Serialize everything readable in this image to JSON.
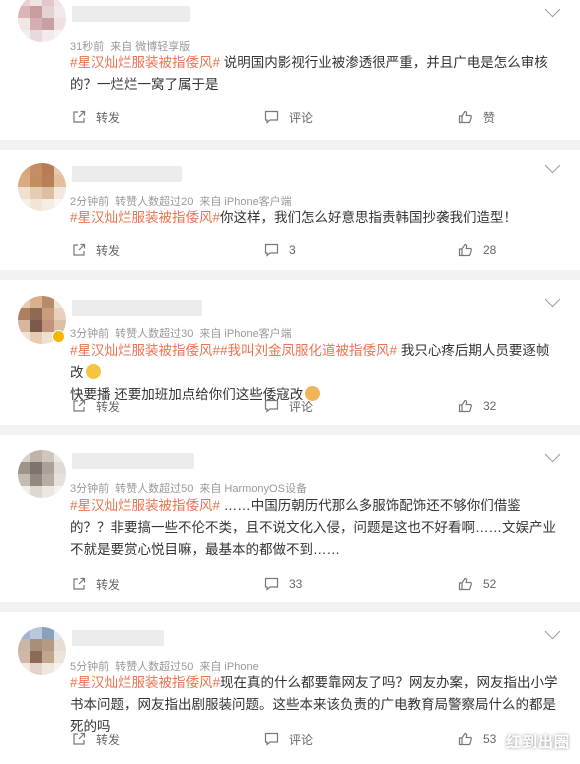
{
  "posts": [
    {
      "meta": [
        "31秒前",
        "来自 微博轻享版"
      ],
      "tag": "#星汉灿烂服装被指倭风#",
      "text": " 说明国内影视行业被渗透很严重，并且广电是怎么审核的？一烂烂一窝了属于是",
      "repost_label": "转发",
      "comment_label": "评论",
      "like_label": "赞"
    },
    {
      "meta": [
        "2分钟前",
        "转赞人数超过20",
        "来自 iPhone客户端"
      ],
      "tag": "#星汉灿烂服装被指倭风#",
      "text": "你这样，我们怎么好意思指责韩国抄袭我们造型！",
      "repost_label": "转发",
      "comment_count": "3",
      "like_count": "28"
    },
    {
      "meta": [
        "3分钟前",
        "转赞人数超过30",
        "来自 iPhone客户端"
      ],
      "tag": "#星汉灿烂服装被指倭风#",
      "tag2": "#我叫刘金凤服化道被指倭风#",
      "text": " 我只心疼后期人员要逐帧改",
      "text2": "快要播 还要加班加点给你们这些倭寇改",
      "repost_label": "转发",
      "comment_label": "评论",
      "like_count": "32"
    },
    {
      "meta": [
        "3分钟前",
        "转赞人数超过50",
        "来自 HarmonyOS设备"
      ],
      "tag": "#星汉灿烂服装被指倭风#",
      "text": " ……中国历朝历代那么多服饰配饰还不够你们借鉴的？？非要搞一些不伦不类，且不说文化入侵，问题是这也不好看啊……文娱产业不就是要赏心悦目嘛，最基本的都做不到……",
      "repost_label": "转发",
      "comment_count": "33",
      "like_count": "52"
    },
    {
      "meta": [
        "5分钟前",
        "转赞人数超过50",
        "来自 iPhone"
      ],
      "tag": "#星汉灿烂服装被指倭风#",
      "text": "现在真的什么都要靠网友了吗？网友办案，网友指出小学书本问题，网友指出剧服装问题。这些本来该负责的广电教育局警察局什么的都是死的吗",
      "repost_label": "转发",
      "comment_label": "评论",
      "like_count": "53"
    }
  ],
  "watermark": "红到出圈"
}
